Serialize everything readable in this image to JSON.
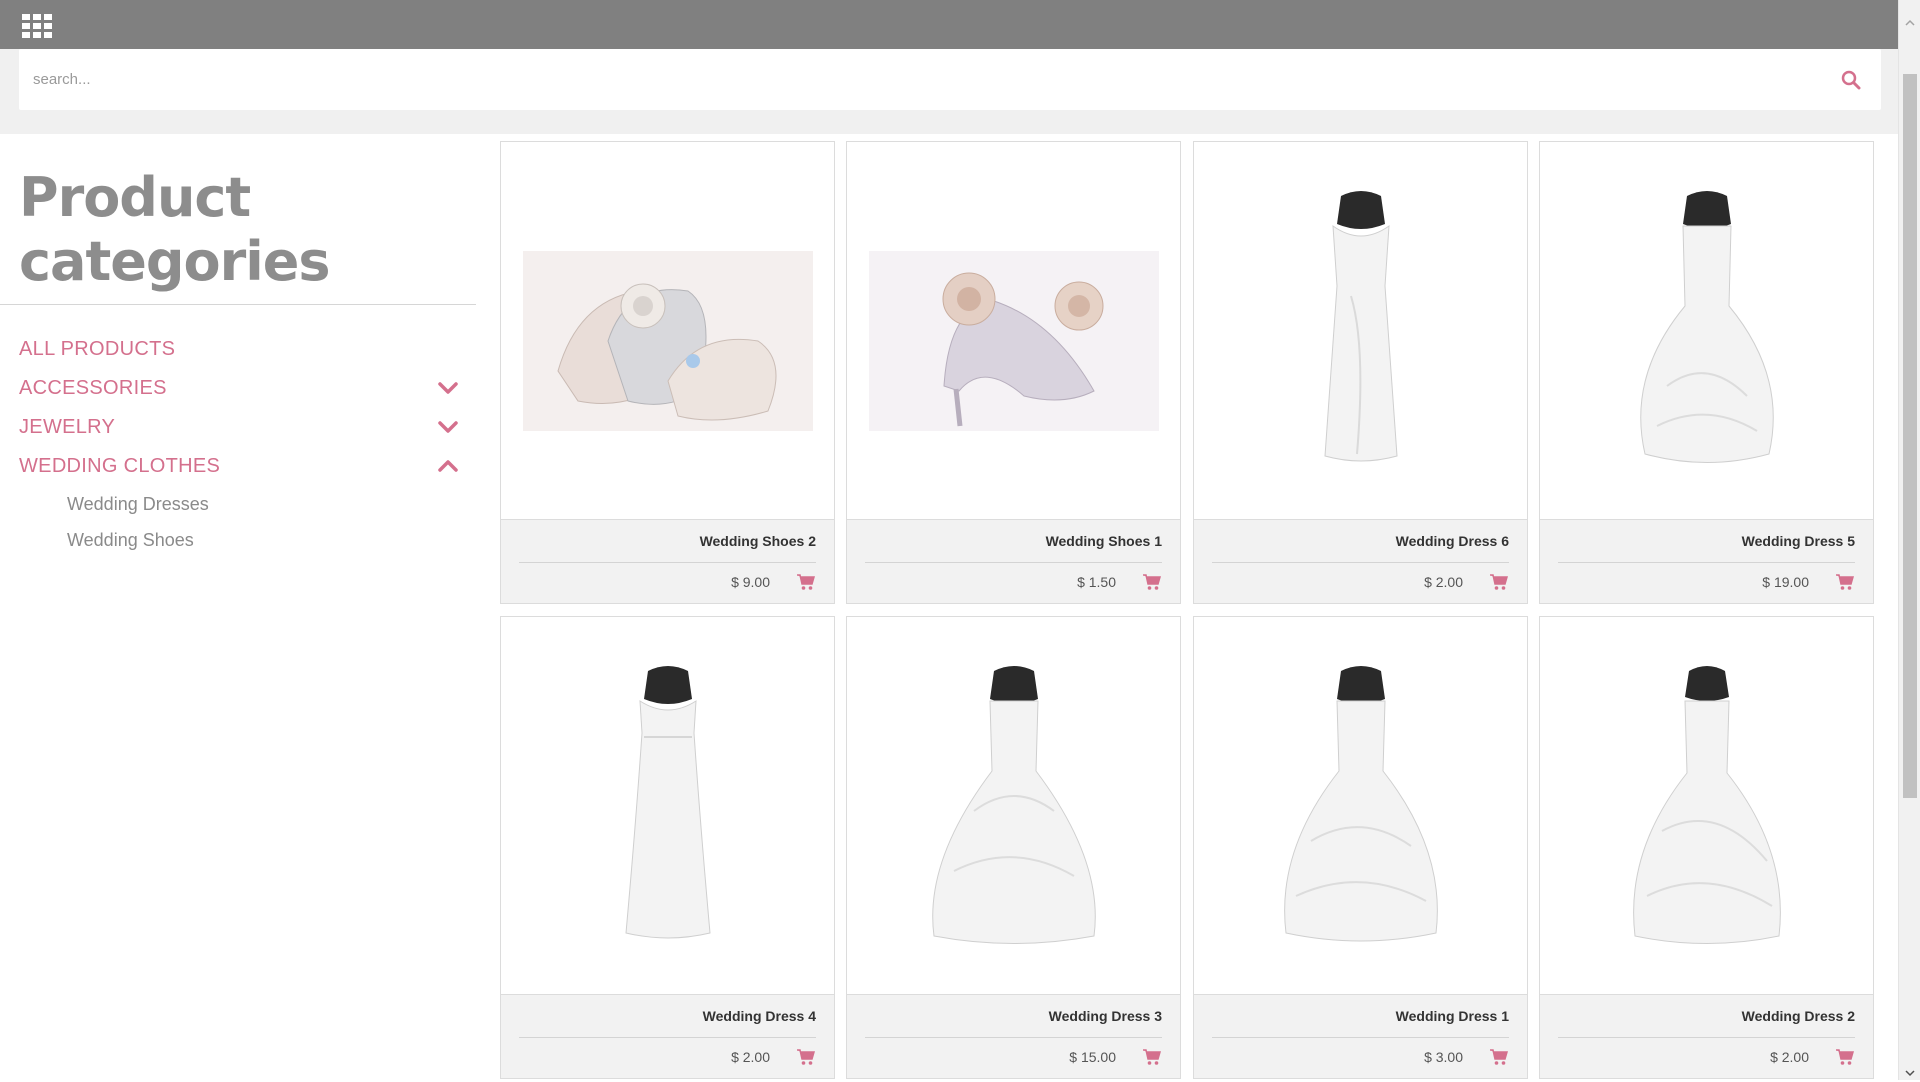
{
  "header": {
    "apps_icon": "grid-apps-icon"
  },
  "search": {
    "placeholder": "search...",
    "value": "",
    "icon": "search-icon"
  },
  "sidebar": {
    "title_line1": "Product",
    "title_line2": "categories",
    "categories": [
      {
        "label": "ALL PRODUCTS",
        "toggle": ""
      },
      {
        "label": "ACCESSORIES",
        "toggle": "chevron-down"
      },
      {
        "label": "JEWELRY",
        "toggle": "chevron-down"
      },
      {
        "label": "WEDDING CLOTHES",
        "toggle": "chevron-up"
      }
    ],
    "subcategories": [
      {
        "label": "Wedding Dresses"
      },
      {
        "label": "Wedding Shoes"
      }
    ]
  },
  "products": [
    {
      "name": "Wedding Shoes 2",
      "price": "$ 9.00",
      "image": "shoes"
    },
    {
      "name": "Wedding Shoes 1",
      "price": "$ 1.50",
      "image": "heel"
    },
    {
      "name": "Wedding Dress 6",
      "price": "$ 2.00",
      "image": "dress-slim"
    },
    {
      "name": "Wedding Dress 5",
      "price": "$ 19.00",
      "image": "dress-ruffle"
    },
    {
      "name": "Wedding Dress 4",
      "price": "$ 2.00",
      "image": "dress-empire"
    },
    {
      "name": "Wedding Dress 3",
      "price": "$ 15.00",
      "image": "dress-ball"
    },
    {
      "name": "Wedding Dress 1",
      "price": "$ 3.00",
      "image": "dress-ball"
    },
    {
      "name": "Wedding Dress 2",
      "price": "$ 2.00",
      "image": "dress-halter"
    }
  ],
  "colors": {
    "accent": "#d4708d",
    "topbar": "#808080",
    "heading": "#8d8d8d"
  }
}
